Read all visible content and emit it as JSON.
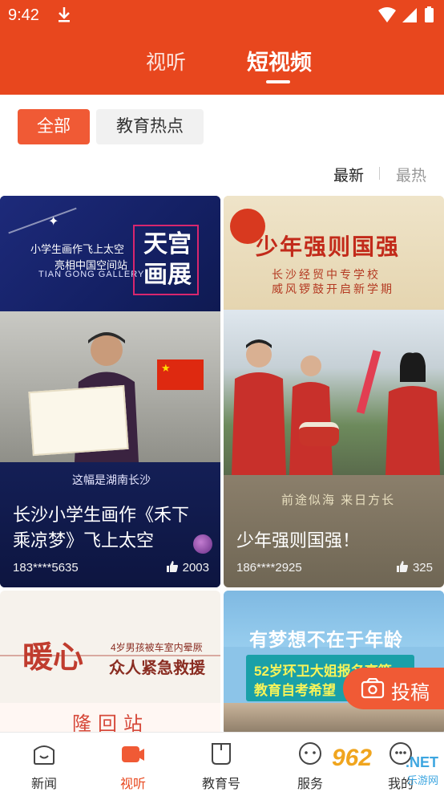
{
  "status_bar": {
    "time": "9:42"
  },
  "top_tabs": {
    "tab1": "视听",
    "tab2": "短视频"
  },
  "filters": {
    "all": "全部",
    "edu_hot": "教育热点"
  },
  "sort": {
    "latest": "最新",
    "hottest": "最热"
  },
  "cards": [
    {
      "banner_line1": "小学生画作飞上太空",
      "banner_line2": "亮相中国空间站",
      "banner_line3": "TIAN GONG   GALLERY",
      "banner_art": "天宫画展",
      "overlay_caption": "这幅是湖南长沙",
      "title": "长沙小学生画作《禾下乘凉梦》飞上太空",
      "author": "183****5635",
      "likes": "2003"
    },
    {
      "banner_title": "少年强则国强",
      "banner_line1": "长沙经贸中专学校",
      "banner_line2": "威风锣鼓开启新学期",
      "overlay_caption": "前途似海 来日方长",
      "title": "少年强则国强！",
      "author": "186****2925",
      "likes": "325"
    },
    {
      "banner_title": "暖心",
      "banner_line1": "4岁男孩被车室内晕厥",
      "banner_line2": "众人紧急救援",
      "banner_bottom": "隆回站"
    },
    {
      "banner_title": "有梦想不在于年龄",
      "banner_line1": "52岁环卫大姐报名高等",
      "banner_line2": "教育自考希望"
    }
  ],
  "fab": {
    "label": "投稿"
  },
  "bottom_tabs": [
    {
      "label": "新闻"
    },
    {
      "label": "视听"
    },
    {
      "label": "教育号"
    },
    {
      "label": "服务"
    },
    {
      "label": "我的"
    }
  ],
  "watermark": {
    "number": "962",
    "net": ".NET",
    "sub": "乐游网"
  },
  "colors": {
    "brand": "#e8471e",
    "accent": "#f05a35",
    "active_tab": "#e8471e"
  },
  "icons": {
    "download": "download-icon",
    "wifi": "wifi-icon",
    "signal": "signal-icon",
    "battery": "battery-icon",
    "like": "thumbs-up-icon",
    "upload": "camera-upload-icon"
  }
}
